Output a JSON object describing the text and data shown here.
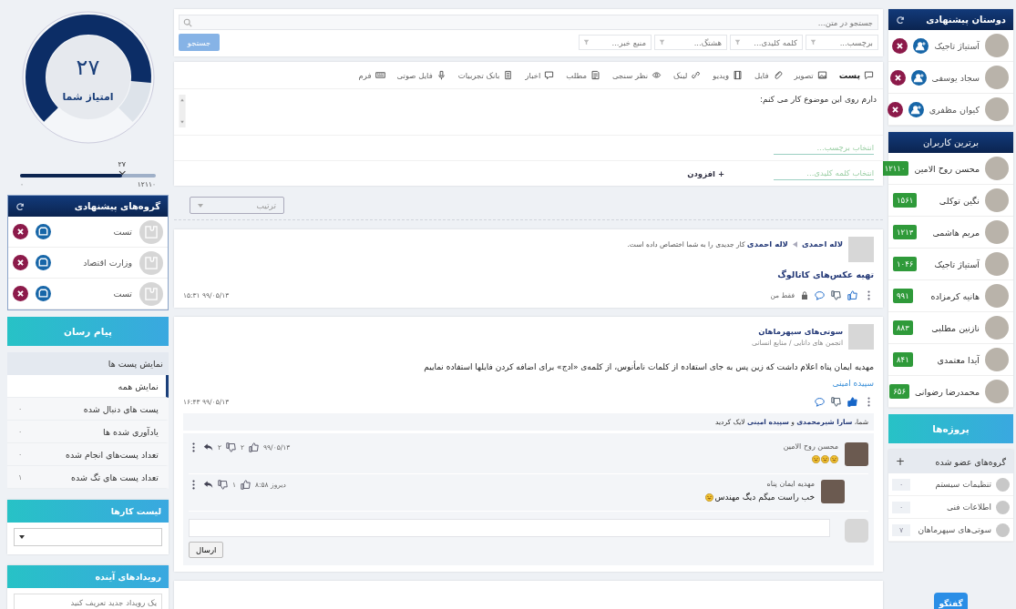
{
  "score": {
    "value": "۲۷",
    "label": "امتیاز شما",
    "level": 0.85
  },
  "range": {
    "marker": "۲۷",
    "min": "۰",
    "max": "۱۲۱۱۰",
    "level": 0.75
  },
  "suggested_groups": {
    "title": "گروه‌های پیشنهادی",
    "items": [
      {
        "name": "تست"
      },
      {
        "name": "وزارت اقتصاد"
      },
      {
        "name": "تست"
      }
    ]
  },
  "messenger_button": "پیام رسان",
  "posts_menu": {
    "title": "نمایش پست ها",
    "items": [
      {
        "label": "نمایش همه",
        "selected": true
      },
      {
        "label": "پست های دنبال شده",
        "count": "۰",
        "selected": false
      },
      {
        "label": "یادآوری شده ها",
        "count": "۰",
        "selected": false
      },
      {
        "label": "تعداد پست‌های انجام شده",
        "count": "۰",
        "selected": false
      },
      {
        "label": "تعداد پست های تگ شده",
        "count": "۱",
        "selected": false
      }
    ]
  },
  "tasks": {
    "title": "لیست کارها"
  },
  "events": {
    "title": "رویدادهای آینده",
    "placeholder": "یک رویداد جدید تعریف کنید"
  },
  "search": {
    "placeholder": "جستجو در متن...",
    "filters": [
      {
        "placeholder": "برچسب..."
      },
      {
        "placeholder": "کلمه کلیدی..."
      },
      {
        "placeholder": "هشتگ..."
      },
      {
        "placeholder": "منبع خبر..."
      }
    ],
    "button": "جستجو"
  },
  "composer": {
    "types": [
      {
        "label": "پست",
        "selected": true
      },
      {
        "label": "تصویر",
        "selected": false
      },
      {
        "label": "فایل",
        "selected": false
      },
      {
        "label": "ویدیو",
        "selected": false
      },
      {
        "label": "لینک",
        "selected": false
      },
      {
        "label": "نظر سنجی",
        "selected": false
      },
      {
        "label": "مطلب",
        "selected": false
      },
      {
        "label": "اخبار",
        "selected": false
      },
      {
        "label": "بانک تجربیات",
        "selected": false
      },
      {
        "label": "فایل صوتی",
        "selected": false
      },
      {
        "label": "فرم",
        "selected": false
      }
    ],
    "text": "دارم روی این موضوع کار می کنم:",
    "tag_placeholder": "انتخاب برچسب...",
    "keyword_placeholder": "انتخاب کلمه کلیدی...",
    "add": "+ افزودن"
  },
  "sort": {
    "placeholder": "ترتیب"
  },
  "posts": [
    {
      "kind": "task",
      "author": "لاله احمدی",
      "headline": "**لاله احمدی** کار جدیدی را به شما اختصاص داده است.",
      "title": "تهیه عکس‌های کاتالوگ",
      "visibility": "فقط من",
      "date": "۹۹/۰۵/۱۳ ۱۵:۳۱",
      "liked": false
    },
    {
      "kind": "group",
      "author": "سوتی‌های سپهرماهان",
      "subtitle": "انجمن های دانایی / منابع انسانی",
      "body": "مهدیه ایمان پناه اعلام داشت که زین پس به جای استفاده از کلمات نامأنوس، از کلمه‌ی «ادج» برای اضافه کردن فایلها استفاده نماییم",
      "signature": "سپیده امینی",
      "date": "۹۹/۰۵/۱۳ ۱۶:۴۳",
      "liked": true,
      "likes": "شما، **سارا شیرمحمدی** و **سپیده امینی** لایک کردید",
      "comments": [
        {
          "kind": "reaction",
          "author": "محسن روح الامین",
          "date": "۹۹/۰۵/۱۳",
          "likes": "۲",
          "dislikes": "۲"
        },
        {
          "kind": "text",
          "author": "مهدیه ایمان پناه",
          "text": "خب راست میگم دیگ مهندس",
          "date": "دیروز ۸:۵۸",
          "likes": "۱"
        }
      ],
      "send": "ارسال"
    }
  ],
  "suggested_friends": {
    "title": "دوستان پیشنهادی",
    "items": [
      {
        "name": "آستیاژ تاجیک"
      },
      {
        "name": "سجاد یوسفی"
      },
      {
        "name": "کیوان مظفری"
      }
    ]
  },
  "top_users": {
    "title": "برترین کاربران",
    "items": [
      {
        "name": "محسن روح الامین",
        "score": "۱۲۱۱۰"
      },
      {
        "name": "نگین توکلی",
        "score": "۱۵۶۱"
      },
      {
        "name": "مریم هاشمی",
        "score": "۱۲۱۳"
      },
      {
        "name": "آستیاژ تاجیک",
        "score": "۱۰۴۶"
      },
      {
        "name": "هانیه کرمزاده",
        "score": "۹۹۱"
      },
      {
        "name": "نازنین مطلبی",
        "score": "۸۸۳"
      },
      {
        "name": "آیدا معتمدی",
        "score": "۸۴۱"
      },
      {
        "name": "محمدرضا رضوانی",
        "score": "۶۵۶"
      }
    ]
  },
  "projects_button": "پروژه‌ها",
  "joined_groups": {
    "title": "گروه‌های عضو شده",
    "add": "+",
    "items": [
      {
        "name": "تنظیمات سیستم",
        "count": "۰"
      },
      {
        "name": "اطلاعات فنی",
        "count": "۰"
      },
      {
        "name": "سوتی‌های سپهرماهان",
        "count": "۷"
      }
    ]
  },
  "chat_button": "گفتگو"
}
